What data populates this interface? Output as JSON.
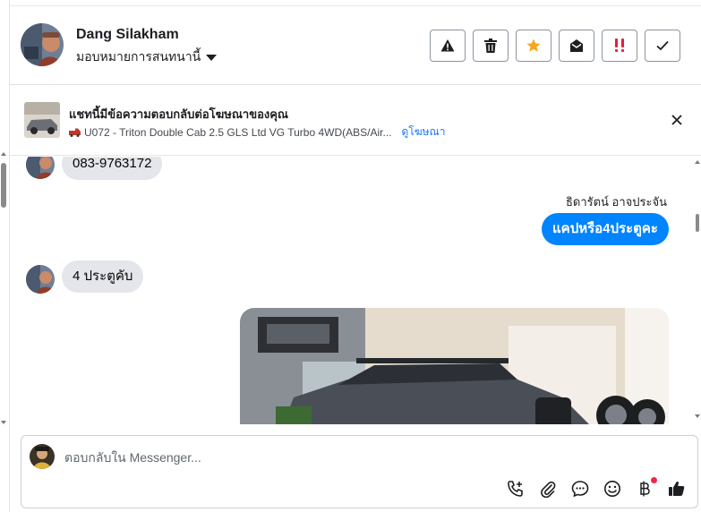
{
  "header": {
    "contact_name": "Dang Silakham",
    "assign_label": "มอบหมายการสนทนานี้",
    "actions": [
      {
        "name": "report-spam",
        "icon": "warning-icon"
      },
      {
        "name": "delete",
        "icon": "trash-icon"
      },
      {
        "name": "star",
        "icon": "star-icon"
      },
      {
        "name": "mark-unread",
        "icon": "envelope-open-icon"
      },
      {
        "name": "follow-up",
        "icon": "double-exclamation-icon"
      },
      {
        "name": "mark-done",
        "icon": "check-icon"
      }
    ]
  },
  "banner": {
    "title": "แชทนี้มีข้อความตอบกลับต่อโฆษณาของคุณ",
    "ad_text": "U072 - Triton Double Cab 2.5 GLS Ltd VG Turbo 4WD(ABS/Air...",
    "link_label": "ดูโฆษณา"
  },
  "thread": {
    "messages": [
      {
        "direction": "in",
        "text": "083-9763172"
      },
      {
        "direction": "out",
        "sender": "ธิดารัตน์ อาจประจัน",
        "text": "แคปหรือ4ประตูคะ"
      },
      {
        "direction": "in",
        "text": "4 ประตูคับ"
      }
    ]
  },
  "composer": {
    "placeholder": "ตอบกลับใน Messenger...",
    "tools": [
      "phone-plus-icon",
      "paperclip-icon",
      "chat-bubble-icon",
      "smiley-icon",
      "baht-icon",
      "thumbs-up-icon"
    ]
  },
  "colors": {
    "accent": "#0084ff",
    "star": "#f5a623",
    "follow_up": "#e41e3f",
    "notification_dot": "#f02849"
  }
}
